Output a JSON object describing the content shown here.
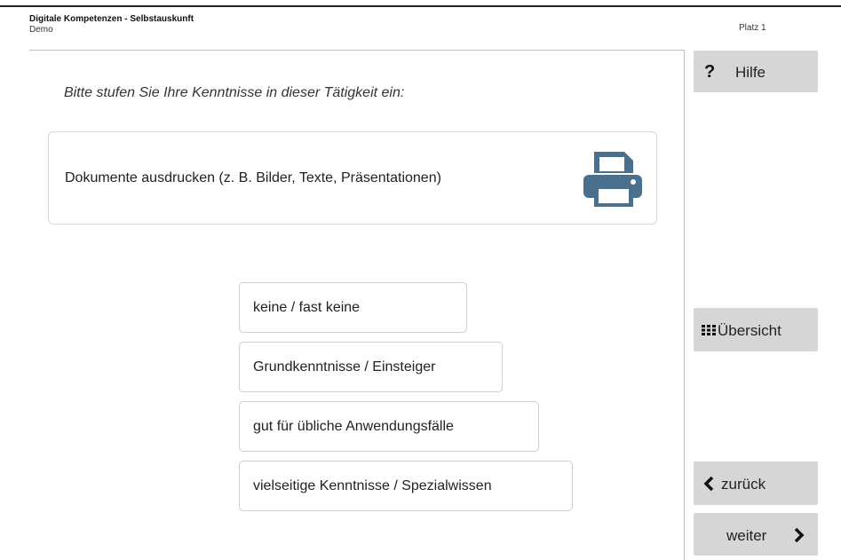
{
  "header": {
    "title": "Digitale Kompetenzen - Selbstauskunft",
    "subtitle": "Demo",
    "place": "Platz 1"
  },
  "main": {
    "prompt": "Bitte stufen Sie Ihre Kenntnisse in dieser Tätigkeit ein:",
    "task": "Dokumente ausdrucken (z. B. Bilder, Texte, Präsentationen)",
    "task_icon": "printer-icon",
    "options": [
      "keine / fast keine",
      "Grundkenntnisse / Einsteiger",
      "gut für übliche Anwendungsfälle",
      "vielseitige Kenntnisse / Spezialwissen"
    ]
  },
  "sidebar": {
    "help_label": "Hilfe",
    "help_icon": "?",
    "overview_label": "Übersicht",
    "back_label": "zurück",
    "next_label": "weiter"
  },
  "colors": {
    "accent_icon": "#4a7090",
    "button_bg": "#d6d6d6",
    "border": "#cfcfcf"
  }
}
